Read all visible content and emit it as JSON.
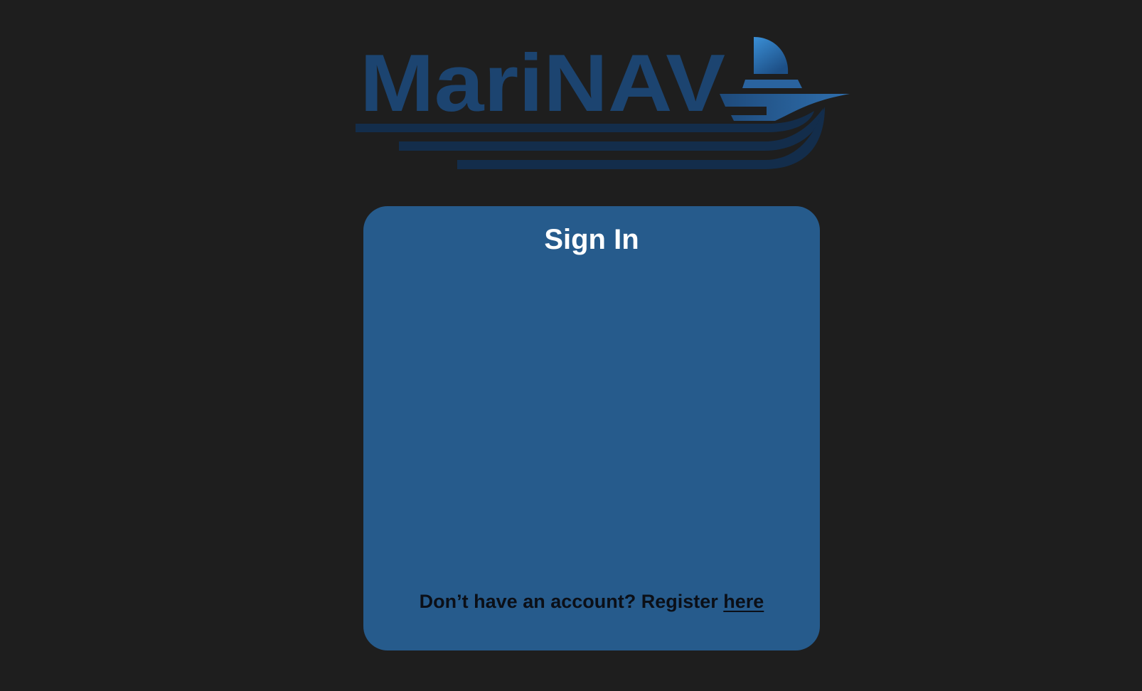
{
  "app": {
    "logo_text": "MariNAV"
  },
  "signin": {
    "title": "Sign In",
    "register_prompt": "Don’t have an account? Register",
    "register_link": "here"
  },
  "colors": {
    "background": "#1e1e1e",
    "card": "#265b8c",
    "logo_primary": "#1c4470",
    "logo_dark": "#132d4b",
    "sail_accent": "#3a8fd6",
    "title_text": "#ffffff",
    "footer_text": "#0b0f17"
  },
  "icons": {
    "logo_mark": "sailboat-icon",
    "logo_waves": "waves-icon"
  }
}
